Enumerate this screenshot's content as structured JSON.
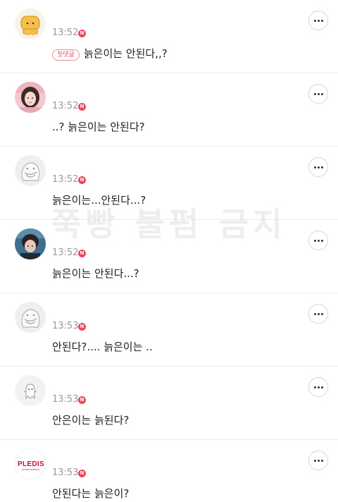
{
  "watermark": "쭉빵 불펌 금지",
  "comments": [
    {
      "avatar": "bread-character-icon",
      "time": "13:52",
      "new_badge": "N",
      "first_badge": "첫댓글",
      "text": "늙은이는 안된다,,?"
    },
    {
      "avatar": "user-photo-girl",
      "time": "13:52",
      "new_badge": "N",
      "text": "..? 늙은이는 안된다?"
    },
    {
      "avatar": "ghost-character-icon",
      "time": "13:52",
      "new_badge": "N",
      "text": "늙은이는...안된다...?"
    },
    {
      "avatar": "user-photo-boy",
      "time": "13:52",
      "new_badge": "N",
      "text": "늙은이는 안된다...?"
    },
    {
      "avatar": "ghost-character-icon",
      "time": "13:53",
      "new_badge": "N",
      "text": "안된다?.... 늙은이는 .."
    },
    {
      "avatar": "small-ghost-icon",
      "time": "13:53",
      "new_badge": "N",
      "text": "안은이는 늙된다?"
    },
    {
      "avatar": "pledis-logo",
      "time": "13:53",
      "new_badge": "N",
      "text": "안된다는 늙은이?",
      "logo_text": "PLEDIS",
      "logo_subtext": "ENTERTAINMENT"
    }
  ],
  "colors": {
    "badge_red": "#f0455b",
    "time_gray": "#999999",
    "divider": "#ececec"
  }
}
